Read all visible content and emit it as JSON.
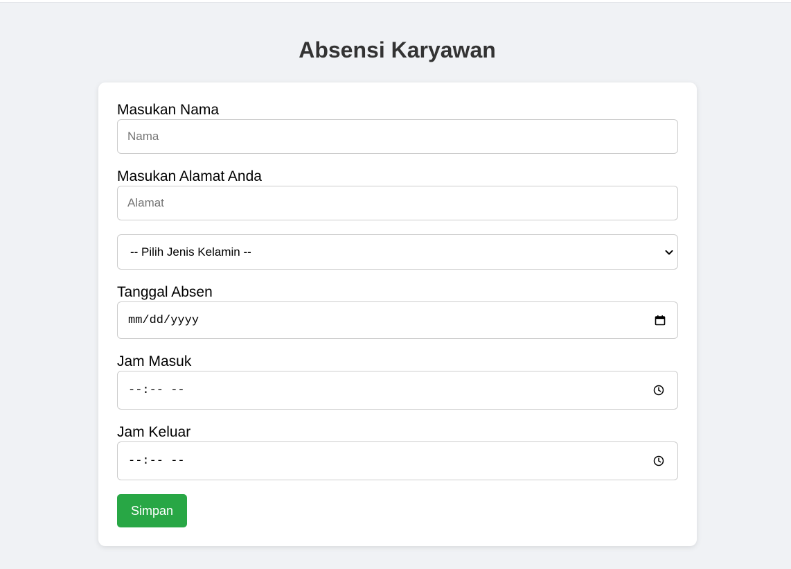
{
  "page": {
    "title": "Absensi Karyawan"
  },
  "form": {
    "name": {
      "label": "Masukan Nama",
      "placeholder": "Nama",
      "value": ""
    },
    "address": {
      "label": "Masukan Alamat Anda",
      "placeholder": "Alamat",
      "value": ""
    },
    "gender": {
      "selected": "-- Pilih Jenis Kelamin --",
      "icon": "chevron-down-icon"
    },
    "date": {
      "label": "Tanggal Absen",
      "display": "mm/dd/yyyy",
      "icon": "calendar-icon"
    },
    "time_in": {
      "label": "Jam Masuk",
      "display": "--:-- --",
      "icon": "clock-icon"
    },
    "time_out": {
      "label": "Jam Keluar",
      "display": "--:-- --",
      "icon": "clock-icon"
    },
    "submit": {
      "label": "Simpan"
    }
  },
  "colors": {
    "background": "#f0f2f5",
    "card": "#ffffff",
    "button": "#28a745",
    "button_text": "#ffffff",
    "title": "#333333",
    "border": "#cccccc"
  }
}
